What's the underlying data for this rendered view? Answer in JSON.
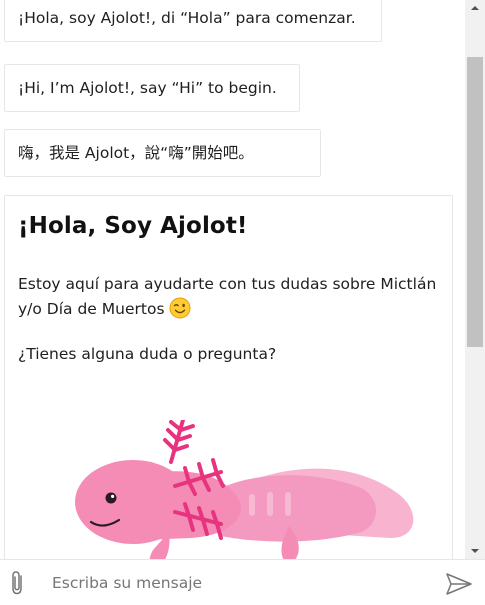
{
  "messages": [
    {
      "text": "¡Hola, soy Ajolot!, di “Hola” para comenzar."
    },
    {
      "text": "¡Hi, I’m Ajolot!, say “Hi” to begin."
    },
    {
      "text": "嗨，我是 Ajolot，說“嗨”開始吧。"
    }
  ],
  "card": {
    "title": "¡Hola, Soy Ajolot!",
    "text": "Estoy aquí para ayudarte con tus dudas sobre Mictlán y/o Día de Muertos",
    "question": "¿Tienes alguna duda o pregunta?",
    "emoji_icon": "winking-face-icon",
    "image": "axolotl-illustration"
  },
  "composer": {
    "placeholder": "Escriba su mensaje",
    "value": "",
    "attach_icon": "paperclip-icon",
    "send_icon": "send-icon"
  },
  "colors": {
    "axolotl_body": "#f48cb6",
    "axolotl_light": "#f8b3cf",
    "gills": "#e8337f",
    "scroll_thumb": "#c1c1c1"
  }
}
